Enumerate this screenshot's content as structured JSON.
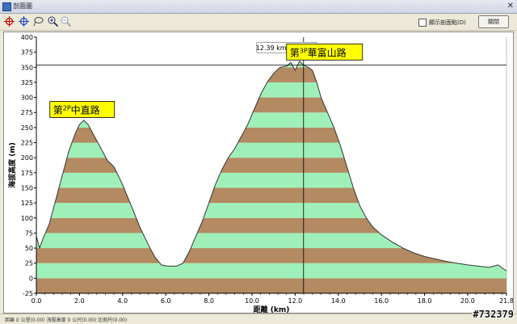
{
  "window": {
    "title": "剖面圖",
    "close_glyph": "✕"
  },
  "toolbar": {
    "icons": [
      "crosshair-red-icon",
      "crosshair-blue-icon",
      "lasso-icon",
      "zoom-in-icon",
      "zoom-out-icon"
    ],
    "checkbox_label": "顯示剖面點(D)",
    "checkbox_checked": false,
    "close_label": "關閉"
  },
  "status": {
    "text": "距離 0 公里(0.00) 海拔高度 0 公尺(0.00) 比例尺(0.00)"
  },
  "watermark": "#732379",
  "colors": {
    "band_green": "#9ff0b8",
    "band_brown": "#b38a62",
    "outline": "#333333",
    "label_bg": "#ffff00"
  },
  "chart_data": {
    "type": "area",
    "xlabel": "距離 (km)",
    "ylabel": "海拔高度 (m)",
    "xlim": [
      0,
      21.8
    ],
    "ylim": [
      -25,
      400
    ],
    "xticks": [
      0.0,
      2.0,
      4.0,
      6.0,
      8.0,
      10.0,
      12.0,
      14.0,
      16.0,
      18.0,
      20.0,
      21.8
    ],
    "xtick_labels": [
      "0.0",
      "2.0",
      "4.0",
      "6.0",
      "8.0",
      "10.0",
      "12.0",
      "14.0",
      "16.0",
      "18.0",
      "20.0",
      "21.8"
    ],
    "yticks": [
      -25,
      0,
      25,
      50,
      75,
      100,
      125,
      150,
      175,
      200,
      225,
      250,
      275,
      300,
      325,
      350,
      375,
      400
    ],
    "ytick_labels": [
      "-25",
      "0",
      "25",
      "50",
      "75",
      "100",
      "125",
      "150",
      "175",
      "200",
      "225",
      "250",
      "275",
      "300",
      "325",
      "350",
      "375",
      "400"
    ],
    "band_step": 25,
    "grid": false,
    "cursor": {
      "x": 12.39,
      "y": 353.9,
      "label": "12.39 km, 353.9 m"
    },
    "annotations": [
      {
        "x": 2.2,
        "y": 268,
        "label_prefix": "第",
        "label_sup": "2P",
        "label_main": "中直路"
      },
      {
        "x": 13.1,
        "y": 358,
        "label_prefix": "第",
        "label_sup": "3P",
        "label_main": "華富山路"
      }
    ],
    "profile": {
      "x": [
        0.0,
        0.15,
        0.3,
        0.6,
        0.9,
        1.2,
        1.5,
        1.8,
        2.0,
        2.2,
        2.4,
        2.7,
        3.0,
        3.3,
        3.6,
        4.0,
        4.4,
        4.8,
        5.2,
        5.5,
        5.8,
        6.1,
        6.5,
        6.8,
        7.1,
        7.4,
        7.7,
        8.0,
        8.3,
        8.6,
        8.9,
        9.2,
        9.5,
        9.8,
        10.1,
        10.4,
        10.7,
        11.0,
        11.3,
        11.6,
        11.8,
        12.0,
        12.2,
        12.39,
        12.6,
        12.8,
        13.0,
        13.2,
        13.5,
        13.8,
        14.1,
        14.4,
        14.7,
        15.0,
        15.3,
        15.6,
        16.0,
        16.5,
        17.0,
        17.5,
        18.0,
        18.5,
        19.0,
        19.5,
        20.0,
        20.5,
        21.0,
        21.4,
        21.8
      ],
      "y": [
        70,
        50,
        65,
        90,
        130,
        170,
        210,
        240,
        255,
        262,
        255,
        235,
        215,
        195,
        185,
        155,
        120,
        85,
        55,
        35,
        22,
        20,
        20,
        25,
        45,
        70,
        95,
        125,
        155,
        180,
        200,
        215,
        235,
        255,
        280,
        305,
        325,
        340,
        350,
        352,
        358,
        345,
        360,
        353.9,
        350,
        345,
        325,
        300,
        275,
        250,
        220,
        185,
        150,
        120,
        100,
        85,
        72,
        60,
        50,
        42,
        36,
        32,
        28,
        25,
        22,
        20,
        18,
        22,
        12
      ]
    }
  }
}
